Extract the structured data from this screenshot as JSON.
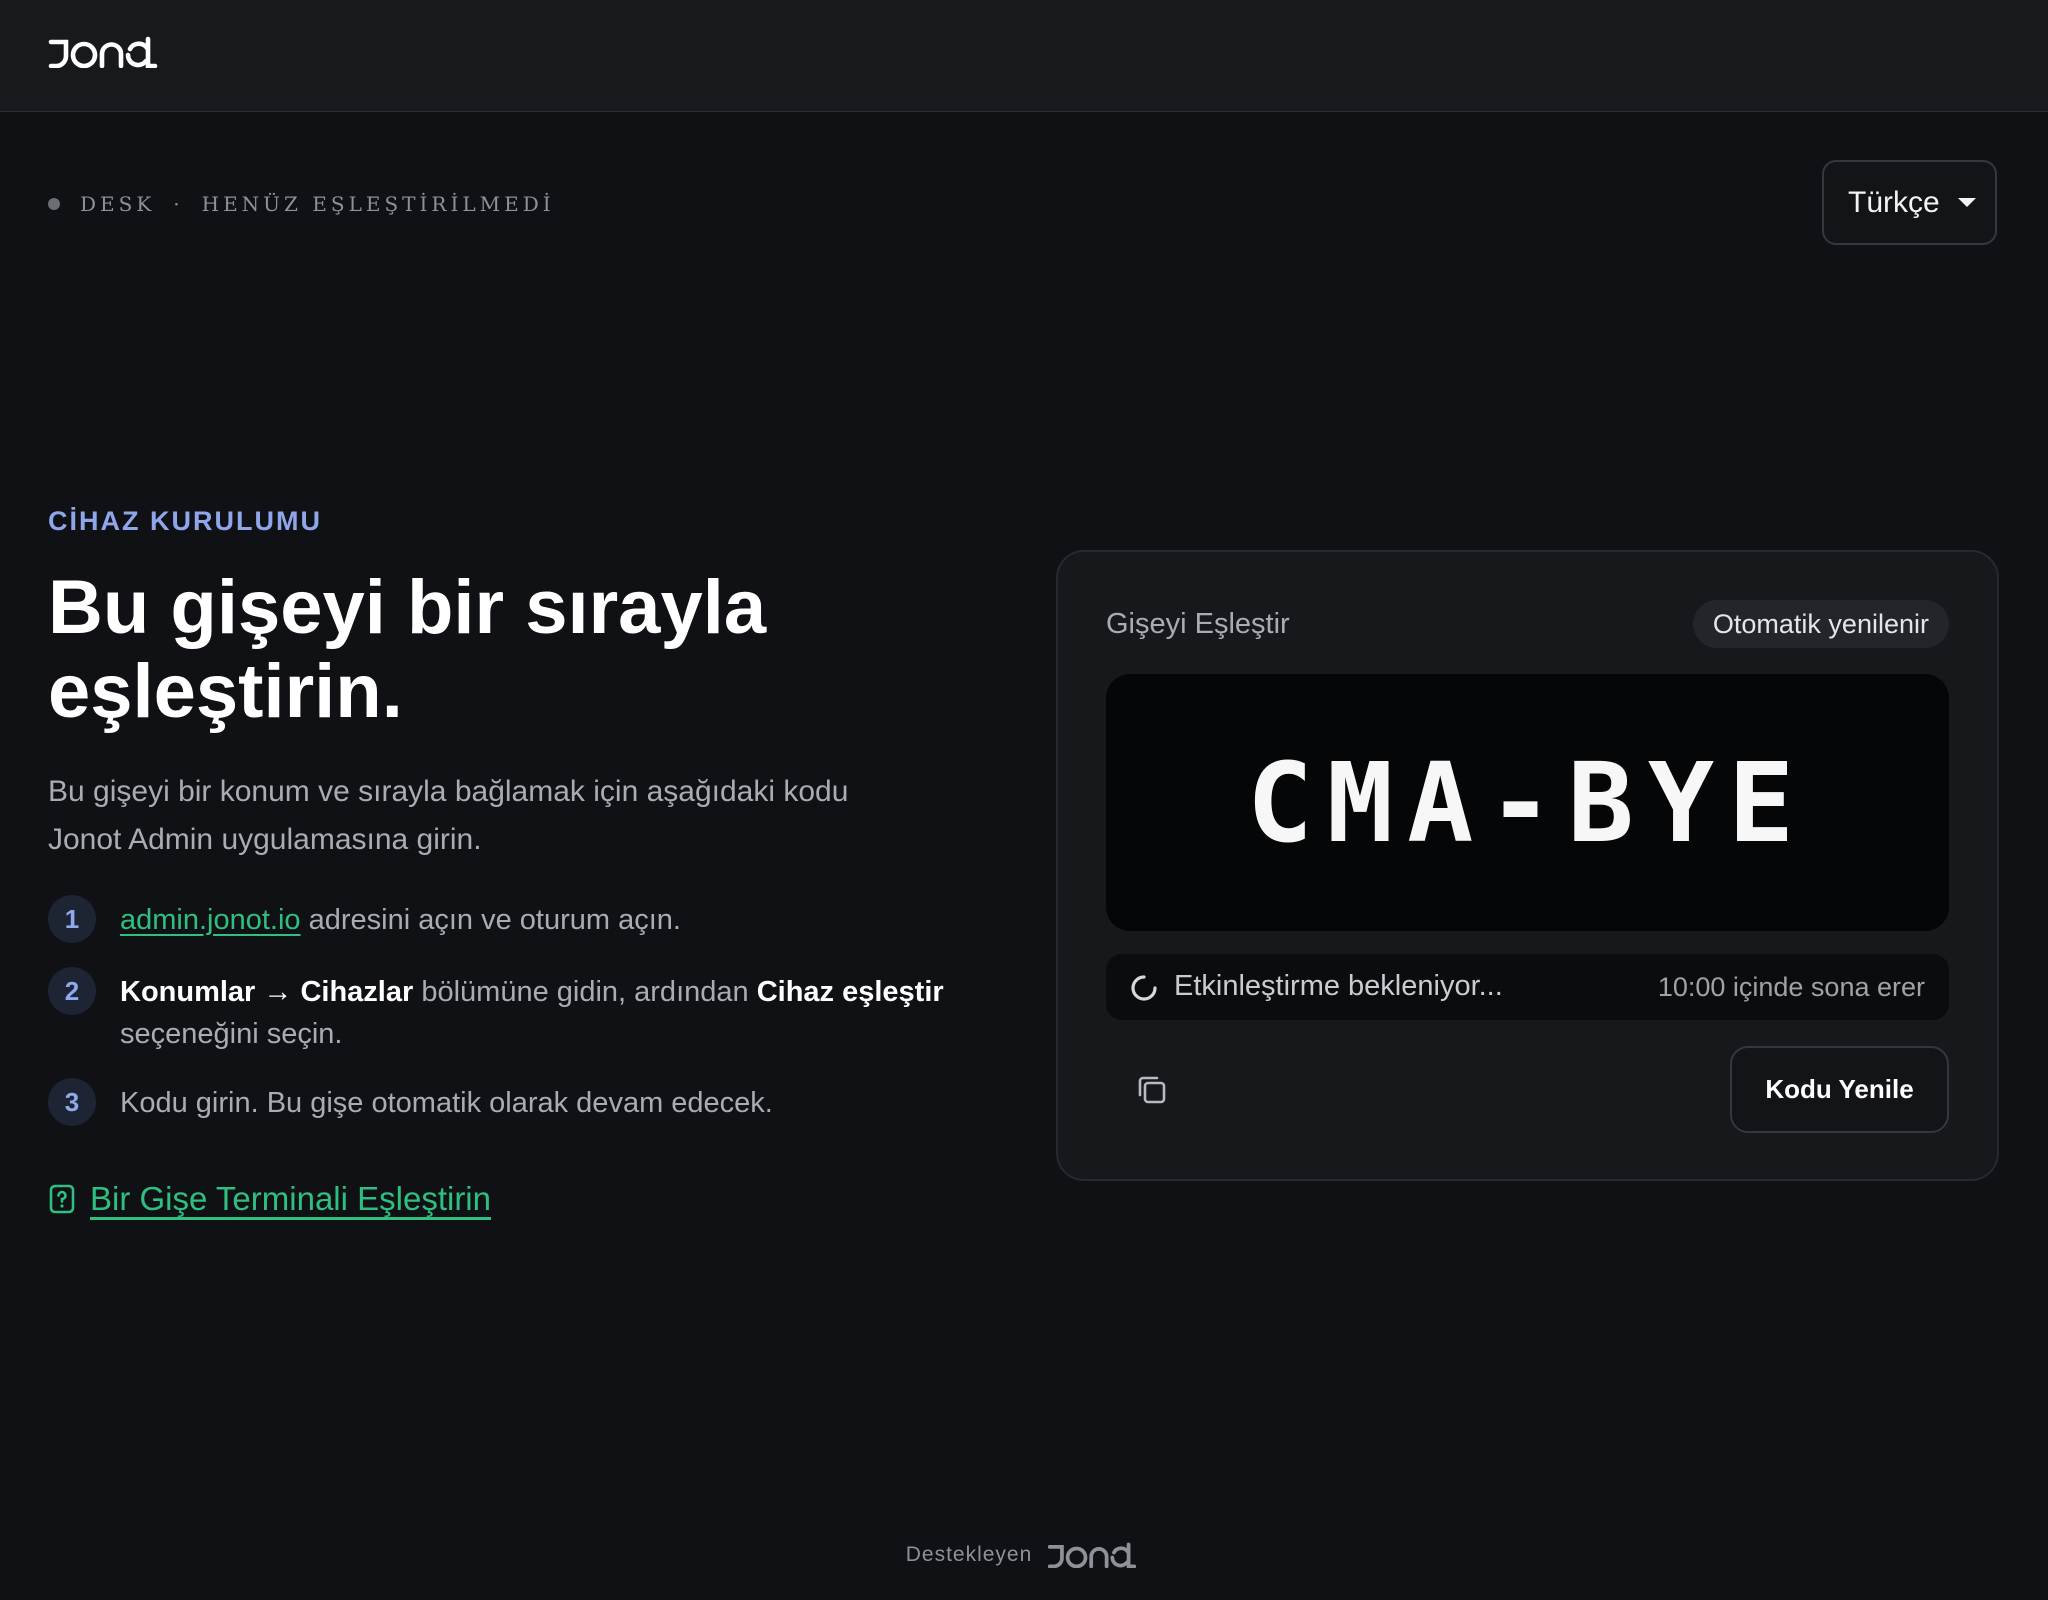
{
  "header": {
    "logo_text": "jonot"
  },
  "status": {
    "device": "DESK",
    "separator": "·",
    "state": "HENÜZ EŞLEŞTİRİLMEDİ"
  },
  "language": {
    "selected": "Türkçe"
  },
  "intro": {
    "eyebrow": "CİHAZ KURULUMU",
    "title": "Bu gişeyi bir sırayla eşleştirin.",
    "lead": "Bu gişeyi bir konum ve sırayla bağlamak için aşağıdaki kodu Jonot Admin uygulamasına girin."
  },
  "steps": [
    {
      "num": "1",
      "link": "admin.jonot.io",
      "rest": " adresini açın ve oturum açın."
    },
    {
      "num": "2",
      "bold1": "Konumlar → Cihazlar",
      "mid": " bölümüne gidin, ardından ",
      "bold2": "Cihaz eşleştir",
      "rest": " seçeneğini seçin."
    },
    {
      "num": "3",
      "text": "Kodu girin. Bu gişe otomatik olarak devam edecek."
    }
  ],
  "help_link": "Bir Gişe Terminali Eşleştirin",
  "card": {
    "title": "Gişeyi Eşleştir",
    "badge": "Otomatik yenilenir",
    "code": "CMA-BYE",
    "waiting": "Etkinleştirme bekleniyor...",
    "expires": "10:00 içinde sona erer",
    "refresh_label": "Kodu Yenile"
  },
  "footer": {
    "powered_by": "Destekleyen",
    "logo_text": "jonot"
  },
  "colors": {
    "accent_link": "#2fbf80",
    "eyebrow": "#8fa6ea",
    "background": "#0f1114"
  },
  "icons": [
    "logo",
    "status-dot",
    "caret-down-icon",
    "help-doc-icon",
    "spinner-icon",
    "copy-icon"
  ]
}
